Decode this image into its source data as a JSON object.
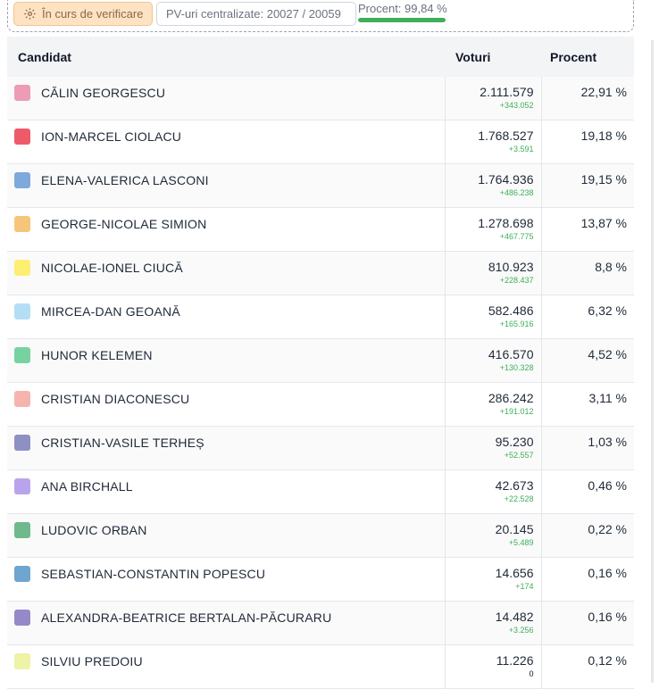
{
  "status": {
    "verify_label": "În curs de verificare",
    "pv_label": "PV-uri centralizate: 20027 / 20059",
    "percent_label": "Procent: 99,84 %",
    "percent_value": 0.9984,
    "progress_color": "#3fae5a"
  },
  "table": {
    "headers": {
      "candidate": "Candidat",
      "votes": "Voturi",
      "percent": "Procent"
    },
    "rows": [
      {
        "name": "CĂLIN GEORGESCU",
        "color": "#ee9bb5",
        "votes": "2.111.579",
        "delta": "+343.052",
        "percent": "22,91 %"
      },
      {
        "name": "ION-MARCEL CIOLACU",
        "color": "#ef5a6a",
        "votes": "1.768.527",
        "delta": "+3.591",
        "percent": "19,18 %"
      },
      {
        "name": "ELENA-VALERICA LASCONI",
        "color": "#7ea9dc",
        "votes": "1.764.936",
        "delta": "+486.238",
        "percent": "19,15 %"
      },
      {
        "name": "GEORGE-NICOLAE SIMION",
        "color": "#f7c57a",
        "votes": "1.278.698",
        "delta": "+467.775",
        "percent": "13,87 %"
      },
      {
        "name": "NICOLAE-IONEL CIUCĂ",
        "color": "#fcef72",
        "votes": "810.923",
        "delta": "+228.437",
        "percent": "8,8 %"
      },
      {
        "name": "MIRCEA-DAN GEOANĂ",
        "color": "#b4def6",
        "votes": "582.486",
        "delta": "+165.916",
        "percent": "6,32 %"
      },
      {
        "name": "HUNOR KELEMEN",
        "color": "#76d3a1",
        "votes": "416.570",
        "delta": "+130.328",
        "percent": "4,52 %"
      },
      {
        "name": "CRISTIAN DIACONESCU",
        "color": "#f6b4ae",
        "votes": "286.242",
        "delta": "+191.012",
        "percent": "3,11 %"
      },
      {
        "name": "CRISTIAN-VASILE TERHEȘ",
        "color": "#8e90c4",
        "votes": "95.230",
        "delta": "+52.557",
        "percent": "1,03 %"
      },
      {
        "name": "ANA BIRCHALL",
        "color": "#b9a4ec",
        "votes": "42.673",
        "delta": "+22.528",
        "percent": "0,46 %"
      },
      {
        "name": "LUDOVIC ORBAN",
        "color": "#6fb98c",
        "votes": "20.145",
        "delta": "+5.489",
        "percent": "0,22 %"
      },
      {
        "name": "SEBASTIAN-CONSTANTIN POPESCU",
        "color": "#6ea6cf",
        "votes": "14.656",
        "delta": "+174",
        "percent": "0,16 %"
      },
      {
        "name": "ALEXANDRA-BEATRICE BERTALAN-PĂCURARU",
        "color": "#9689ca",
        "votes": "14.482",
        "delta": "+3.256",
        "percent": "0,16 %"
      },
      {
        "name": "SILVIU PREDOIU",
        "color": "#eef3a5",
        "votes": "11.226",
        "delta": "0",
        "percent": "0,12 %"
      }
    ]
  }
}
